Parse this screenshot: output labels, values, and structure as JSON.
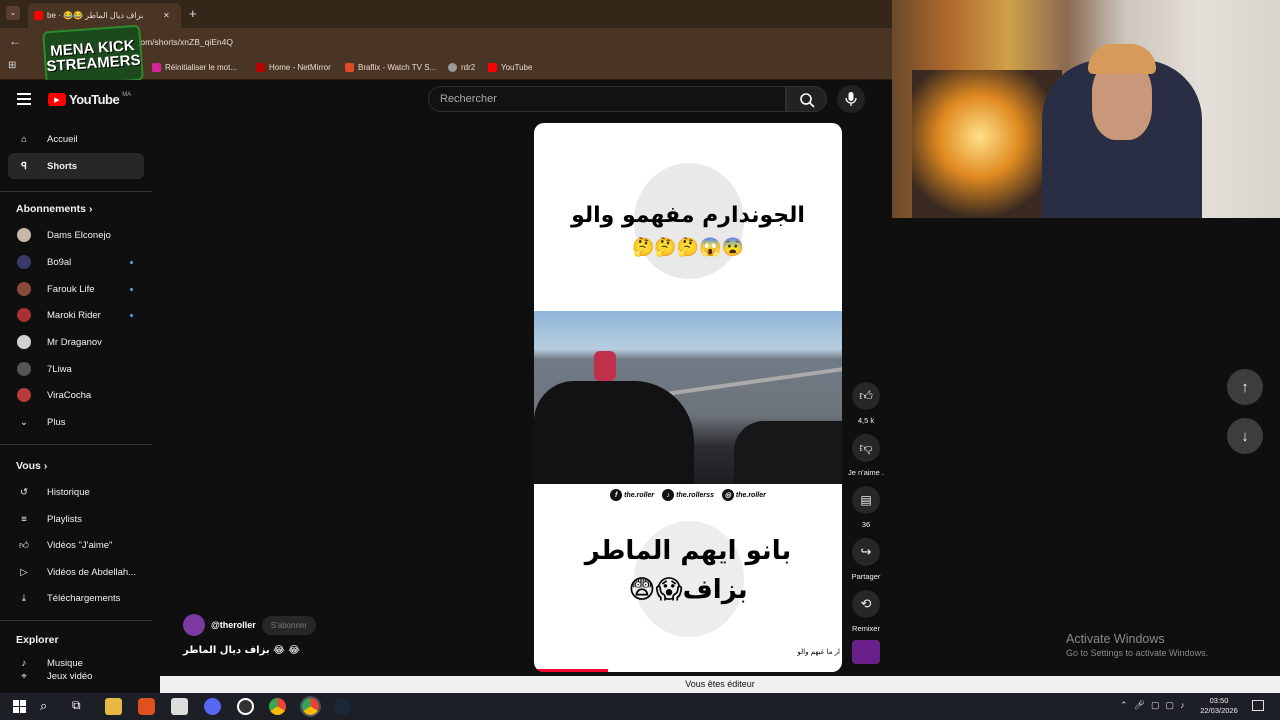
{
  "browser": {
    "tab_title": "be · 😂😂 بزاف ديال الماطر",
    "url": ":om/shorts/xnZB_qiEn4Q",
    "bookmarks": [
      "Réinitialiser le mot...",
      "Home - NetMirror",
      "Braflix - Watch TV S...",
      "rdr2",
      "YouTube"
    ]
  },
  "overlay": {
    "logo_line1": "MENA KICK",
    "logo_line2": "STREAMERS"
  },
  "header": {
    "logo_text": "YouTube",
    "country": "MA",
    "search_placeholder": "Rechercher"
  },
  "sidebar": {
    "main": [
      {
        "label": "Accueil"
      },
      {
        "label": "Shorts"
      }
    ],
    "subscriptions_title": "Abonnements",
    "subscriptions": [
      {
        "label": "Dams Elconejo",
        "color": "#c9b8a8",
        "dot": false
      },
      {
        "label": "Bo9al",
        "color": "#3b3b6b",
        "dot": true
      },
      {
        "label": "Farouk Life",
        "color": "#8a4a3a",
        "dot": true
      },
      {
        "label": "Maroki Rider",
        "color": "#a83232",
        "dot": true
      },
      {
        "label": "Mr Draganov",
        "color": "#d0d0d0",
        "dot": false
      },
      {
        "label": "7Liwa",
        "color": "#555555",
        "dot": false
      },
      {
        "label": "ViraCocha",
        "color": "#b83a3a",
        "dot": false
      }
    ],
    "more": "Plus",
    "you_title": "Vous",
    "you": [
      {
        "label": "Historique",
        "icon": "history-icon"
      },
      {
        "label": "Playlists",
        "icon": "playlist-icon"
      },
      {
        "label": "Vidéos \"J'aime\"",
        "icon": "thumbs-up-icon"
      },
      {
        "label": "Vidéos de Abdellah...",
        "icon": "video-icon"
      },
      {
        "label": "Téléchargements",
        "icon": "download-icon"
      }
    ],
    "explore_title": "Explorer",
    "explore": [
      {
        "label": "Musique"
      },
      {
        "label": "Jeux vidéo"
      }
    ]
  },
  "video": {
    "top_text": "الجوندارم مفهمو والو",
    "top_emoji": "🤔🤔🤔😱😨",
    "social": [
      "the.roller",
      "the.rollerss",
      "the.roller"
    ],
    "bottom_text_1": "بانو ايهم الماطر",
    "bottom_text_2": "😨😱بزاف",
    "ticker": "ار ما غبهم والو",
    "progress": 0.24
  },
  "actions": {
    "likes": "4,5 k",
    "dislike": "Je n'aime .",
    "comments": "36",
    "share": "Partager",
    "remix": "Remixer"
  },
  "channel": {
    "handle": "@theroller",
    "subscribe": "S'abonner",
    "caption": "بزاف ديال الماطر 😂 😂"
  },
  "windows": {
    "activate_title": "Activate Windows",
    "activate_sub": "Go to Settings to activate Windows.",
    "editor_bar": "Vous êtes éditeur",
    "time": "03:50",
    "date": "22/03/2026"
  }
}
